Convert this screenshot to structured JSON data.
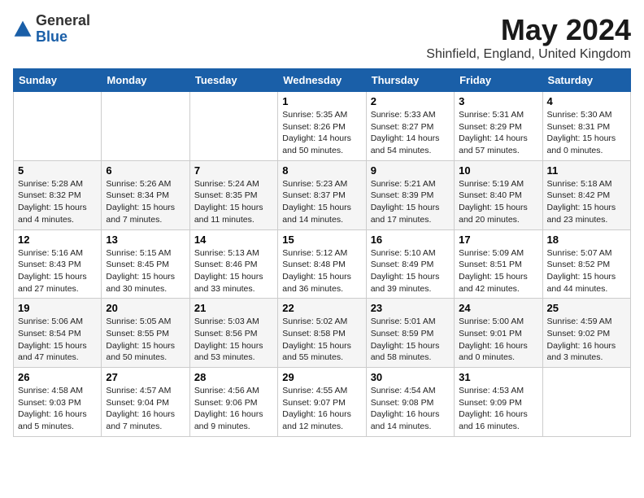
{
  "header": {
    "logo_general": "General",
    "logo_blue": "Blue",
    "month_title": "May 2024",
    "location": "Shinfield, England, United Kingdom"
  },
  "weekdays": [
    "Sunday",
    "Monday",
    "Tuesday",
    "Wednesday",
    "Thursday",
    "Friday",
    "Saturday"
  ],
  "weeks": [
    [
      {
        "day": "",
        "info": ""
      },
      {
        "day": "",
        "info": ""
      },
      {
        "day": "",
        "info": ""
      },
      {
        "day": "1",
        "info": "Sunrise: 5:35 AM\nSunset: 8:26 PM\nDaylight: 14 hours\nand 50 minutes."
      },
      {
        "day": "2",
        "info": "Sunrise: 5:33 AM\nSunset: 8:27 PM\nDaylight: 14 hours\nand 54 minutes."
      },
      {
        "day": "3",
        "info": "Sunrise: 5:31 AM\nSunset: 8:29 PM\nDaylight: 14 hours\nand 57 minutes."
      },
      {
        "day": "4",
        "info": "Sunrise: 5:30 AM\nSunset: 8:31 PM\nDaylight: 15 hours\nand 0 minutes."
      }
    ],
    [
      {
        "day": "5",
        "info": "Sunrise: 5:28 AM\nSunset: 8:32 PM\nDaylight: 15 hours\nand 4 minutes."
      },
      {
        "day": "6",
        "info": "Sunrise: 5:26 AM\nSunset: 8:34 PM\nDaylight: 15 hours\nand 7 minutes."
      },
      {
        "day": "7",
        "info": "Sunrise: 5:24 AM\nSunset: 8:35 PM\nDaylight: 15 hours\nand 11 minutes."
      },
      {
        "day": "8",
        "info": "Sunrise: 5:23 AM\nSunset: 8:37 PM\nDaylight: 15 hours\nand 14 minutes."
      },
      {
        "day": "9",
        "info": "Sunrise: 5:21 AM\nSunset: 8:39 PM\nDaylight: 15 hours\nand 17 minutes."
      },
      {
        "day": "10",
        "info": "Sunrise: 5:19 AM\nSunset: 8:40 PM\nDaylight: 15 hours\nand 20 minutes."
      },
      {
        "day": "11",
        "info": "Sunrise: 5:18 AM\nSunset: 8:42 PM\nDaylight: 15 hours\nand 23 minutes."
      }
    ],
    [
      {
        "day": "12",
        "info": "Sunrise: 5:16 AM\nSunset: 8:43 PM\nDaylight: 15 hours\nand 27 minutes."
      },
      {
        "day": "13",
        "info": "Sunrise: 5:15 AM\nSunset: 8:45 PM\nDaylight: 15 hours\nand 30 minutes."
      },
      {
        "day": "14",
        "info": "Sunrise: 5:13 AM\nSunset: 8:46 PM\nDaylight: 15 hours\nand 33 minutes."
      },
      {
        "day": "15",
        "info": "Sunrise: 5:12 AM\nSunset: 8:48 PM\nDaylight: 15 hours\nand 36 minutes."
      },
      {
        "day": "16",
        "info": "Sunrise: 5:10 AM\nSunset: 8:49 PM\nDaylight: 15 hours\nand 39 minutes."
      },
      {
        "day": "17",
        "info": "Sunrise: 5:09 AM\nSunset: 8:51 PM\nDaylight: 15 hours\nand 42 minutes."
      },
      {
        "day": "18",
        "info": "Sunrise: 5:07 AM\nSunset: 8:52 PM\nDaylight: 15 hours\nand 44 minutes."
      }
    ],
    [
      {
        "day": "19",
        "info": "Sunrise: 5:06 AM\nSunset: 8:54 PM\nDaylight: 15 hours\nand 47 minutes."
      },
      {
        "day": "20",
        "info": "Sunrise: 5:05 AM\nSunset: 8:55 PM\nDaylight: 15 hours\nand 50 minutes."
      },
      {
        "day": "21",
        "info": "Sunrise: 5:03 AM\nSunset: 8:56 PM\nDaylight: 15 hours\nand 53 minutes."
      },
      {
        "day": "22",
        "info": "Sunrise: 5:02 AM\nSunset: 8:58 PM\nDaylight: 15 hours\nand 55 minutes."
      },
      {
        "day": "23",
        "info": "Sunrise: 5:01 AM\nSunset: 8:59 PM\nDaylight: 15 hours\nand 58 minutes."
      },
      {
        "day": "24",
        "info": "Sunrise: 5:00 AM\nSunset: 9:01 PM\nDaylight: 16 hours\nand 0 minutes."
      },
      {
        "day": "25",
        "info": "Sunrise: 4:59 AM\nSunset: 9:02 PM\nDaylight: 16 hours\nand 3 minutes."
      }
    ],
    [
      {
        "day": "26",
        "info": "Sunrise: 4:58 AM\nSunset: 9:03 PM\nDaylight: 16 hours\nand 5 minutes."
      },
      {
        "day": "27",
        "info": "Sunrise: 4:57 AM\nSunset: 9:04 PM\nDaylight: 16 hours\nand 7 minutes."
      },
      {
        "day": "28",
        "info": "Sunrise: 4:56 AM\nSunset: 9:06 PM\nDaylight: 16 hours\nand 9 minutes."
      },
      {
        "day": "29",
        "info": "Sunrise: 4:55 AM\nSunset: 9:07 PM\nDaylight: 16 hours\nand 12 minutes."
      },
      {
        "day": "30",
        "info": "Sunrise: 4:54 AM\nSunset: 9:08 PM\nDaylight: 16 hours\nand 14 minutes."
      },
      {
        "day": "31",
        "info": "Sunrise: 4:53 AM\nSunset: 9:09 PM\nDaylight: 16 hours\nand 16 minutes."
      },
      {
        "day": "",
        "info": ""
      }
    ]
  ]
}
